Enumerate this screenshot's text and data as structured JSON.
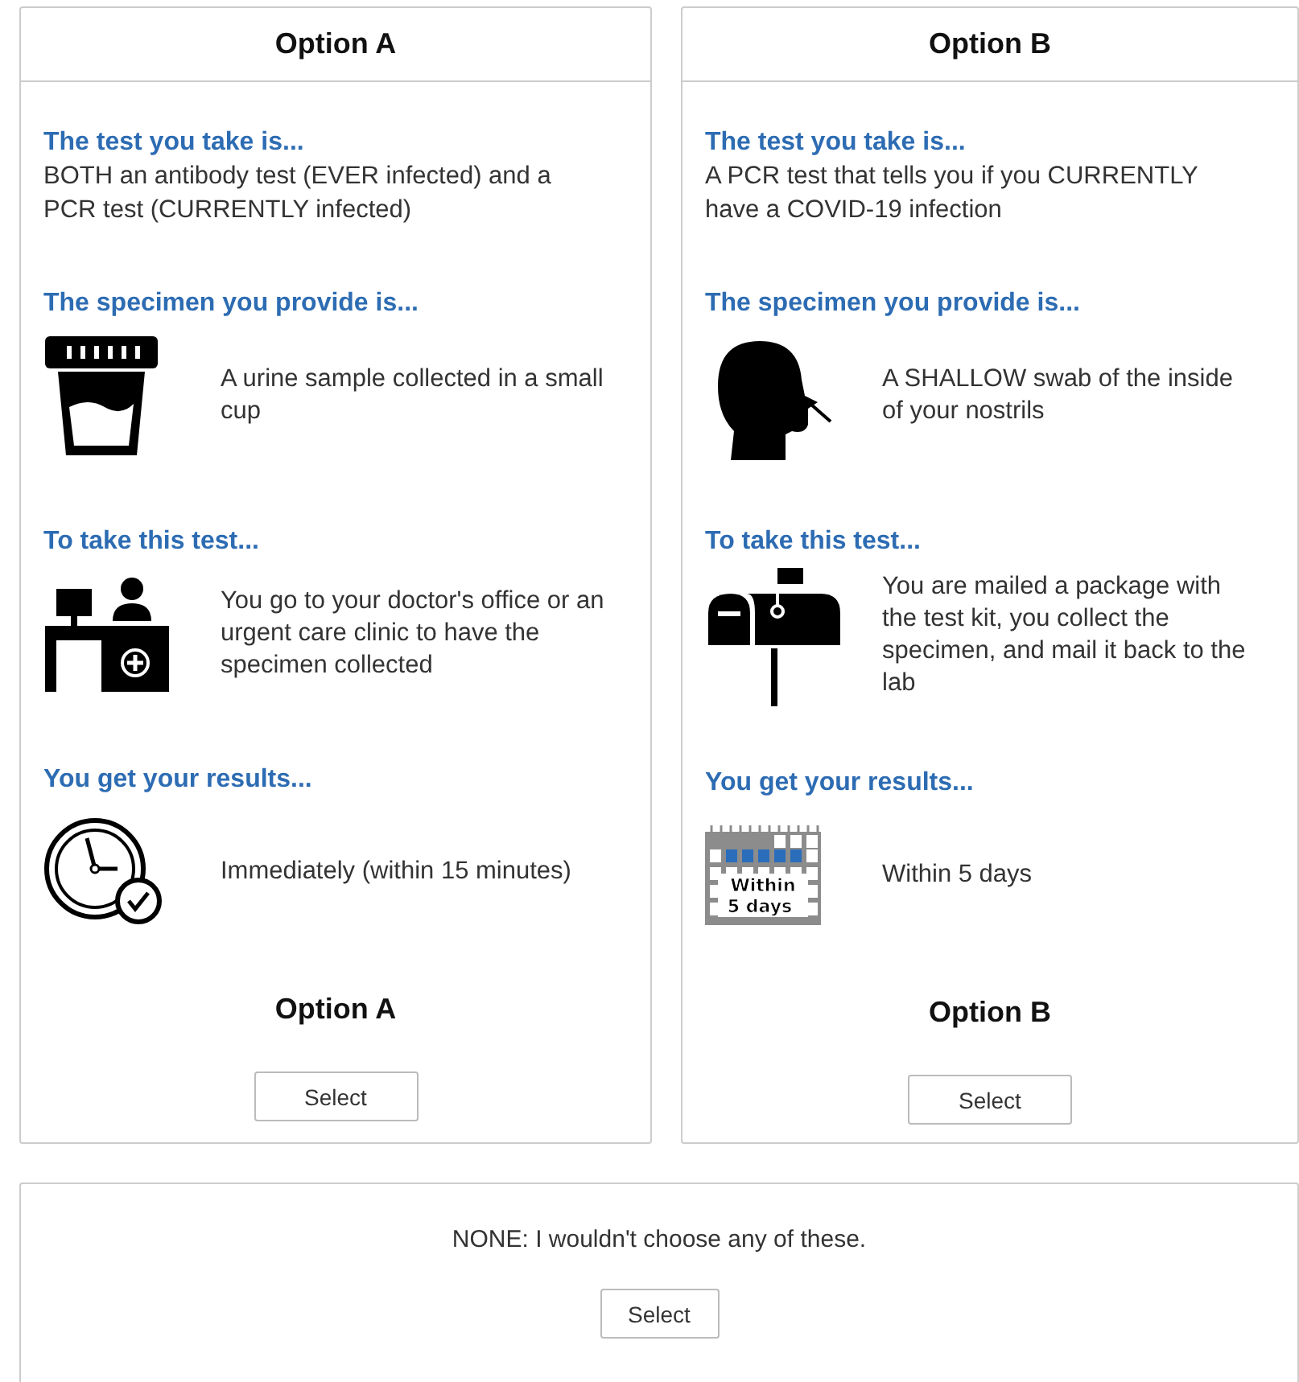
{
  "options": [
    {
      "title": "Option A",
      "sections": [
        {
          "heading": "The test you take is...",
          "text": "BOTH an antibody test (EVER infected) and a PCR test (CURRENTLY infected)"
        },
        {
          "heading": "The specimen you provide is...",
          "kind": "cup",
          "text": "A urine sample collected in a small cup"
        },
        {
          "heading": "To take this test...",
          "kind": "desk",
          "text": "You go to your doctor's office or an urgent care clinic to have the specimen collected"
        },
        {
          "heading": "You get your results...",
          "kind": "clock",
          "text": "Immediately (within 15 minutes)"
        }
      ],
      "footer_title": "Option A",
      "button": "Select"
    },
    {
      "title": "Option B",
      "sections": [
        {
          "heading": "The test you take is...",
          "text": "A PCR test that tells you if you CURRENTLY have a COVID-19 infection"
        },
        {
          "heading": "The specimen you provide is...",
          "kind": "head",
          "text": "A SHALLOW swab of the inside of your nostrils"
        },
        {
          "heading": "To take this test...",
          "kind": "mailbox",
          "text": "You are mailed a package with the test kit, you collect the specimen, and mail it back to the lab"
        },
        {
          "heading": "You get your results...",
          "kind": "calendar",
          "icon_label": [
            "Within",
            "5 days"
          ],
          "text": "Within 5 days"
        }
      ],
      "footer_title": "Option B",
      "button": "Select"
    }
  ],
  "none_option": {
    "text": "NONE: I wouldn't choose any of these.",
    "button": "Select"
  }
}
